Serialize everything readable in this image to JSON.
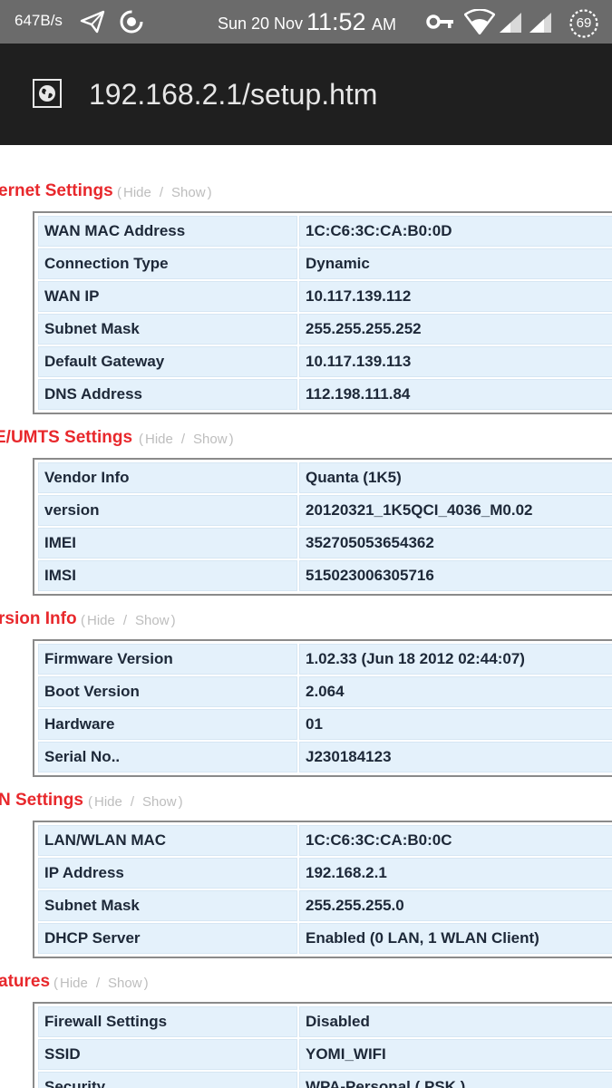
{
  "status_bar": {
    "net_speed": "647B/s",
    "date": "Sun 20 Nov",
    "time": "11:52",
    "ampm": "AM",
    "battery": "69",
    "icons": [
      "telegram-icon",
      "sync-ring-icon",
      "vpn-key-icon",
      "wifi-icon",
      "signal-icon",
      "signal-icon",
      "battery-icon"
    ]
  },
  "browser": {
    "url": "192.168.2.1/setup.htm",
    "site_icon": "globe-icon"
  },
  "links": {
    "hide": "Hide",
    "show": "Show",
    "open": "(",
    "sep": "/",
    "close": ")"
  },
  "sections": [
    {
      "title": "ernet Settings",
      "rows": [
        [
          "WAN MAC Address",
          "1C:C6:3C:CA:B0:0D"
        ],
        [
          "Connection Type",
          "Dynamic"
        ],
        [
          "WAN IP",
          "10.117.139.112"
        ],
        [
          "Subnet Mask",
          "255.255.255.252"
        ],
        [
          "Default Gateway",
          "10.117.139.113"
        ],
        [
          "DNS Address",
          "112.198.111.84"
        ]
      ]
    },
    {
      "title": "E/UMTS Settings",
      "rows": [
        [
          "Vendor Info",
          "Quanta (1K5)"
        ],
        [
          "version",
          "20120321_1K5QCI_4036_M0.02"
        ],
        [
          "IMEI",
          "352705053654362"
        ],
        [
          "IMSI",
          "515023006305716"
        ]
      ]
    },
    {
      "title": "rsion Info",
      "rows": [
        [
          "Firmware Version",
          "1.02.33 (Jun 18 2012 02:44:07)"
        ],
        [
          "Boot Version",
          "2.064"
        ],
        [
          "Hardware",
          "01"
        ],
        [
          "Serial No..",
          "J230184123"
        ]
      ]
    },
    {
      "title": "N Settings",
      "rows": [
        [
          "LAN/WLAN MAC",
          "1C:C6:3C:CA:B0:0C"
        ],
        [
          "IP Address",
          "192.168.2.1"
        ],
        [
          "Subnet Mask",
          "255.255.255.0"
        ],
        [
          "DHCP Server",
          "Enabled (0 LAN, 1 WLAN Client)"
        ]
      ]
    },
    {
      "title": "atures",
      "rows": [
        [
          "Firewall Settings",
          "Disabled"
        ],
        [
          "SSID",
          "YOMI_WIFI"
        ],
        [
          "Security",
          "WPA-Personal ( PSK )"
        ]
      ]
    }
  ]
}
